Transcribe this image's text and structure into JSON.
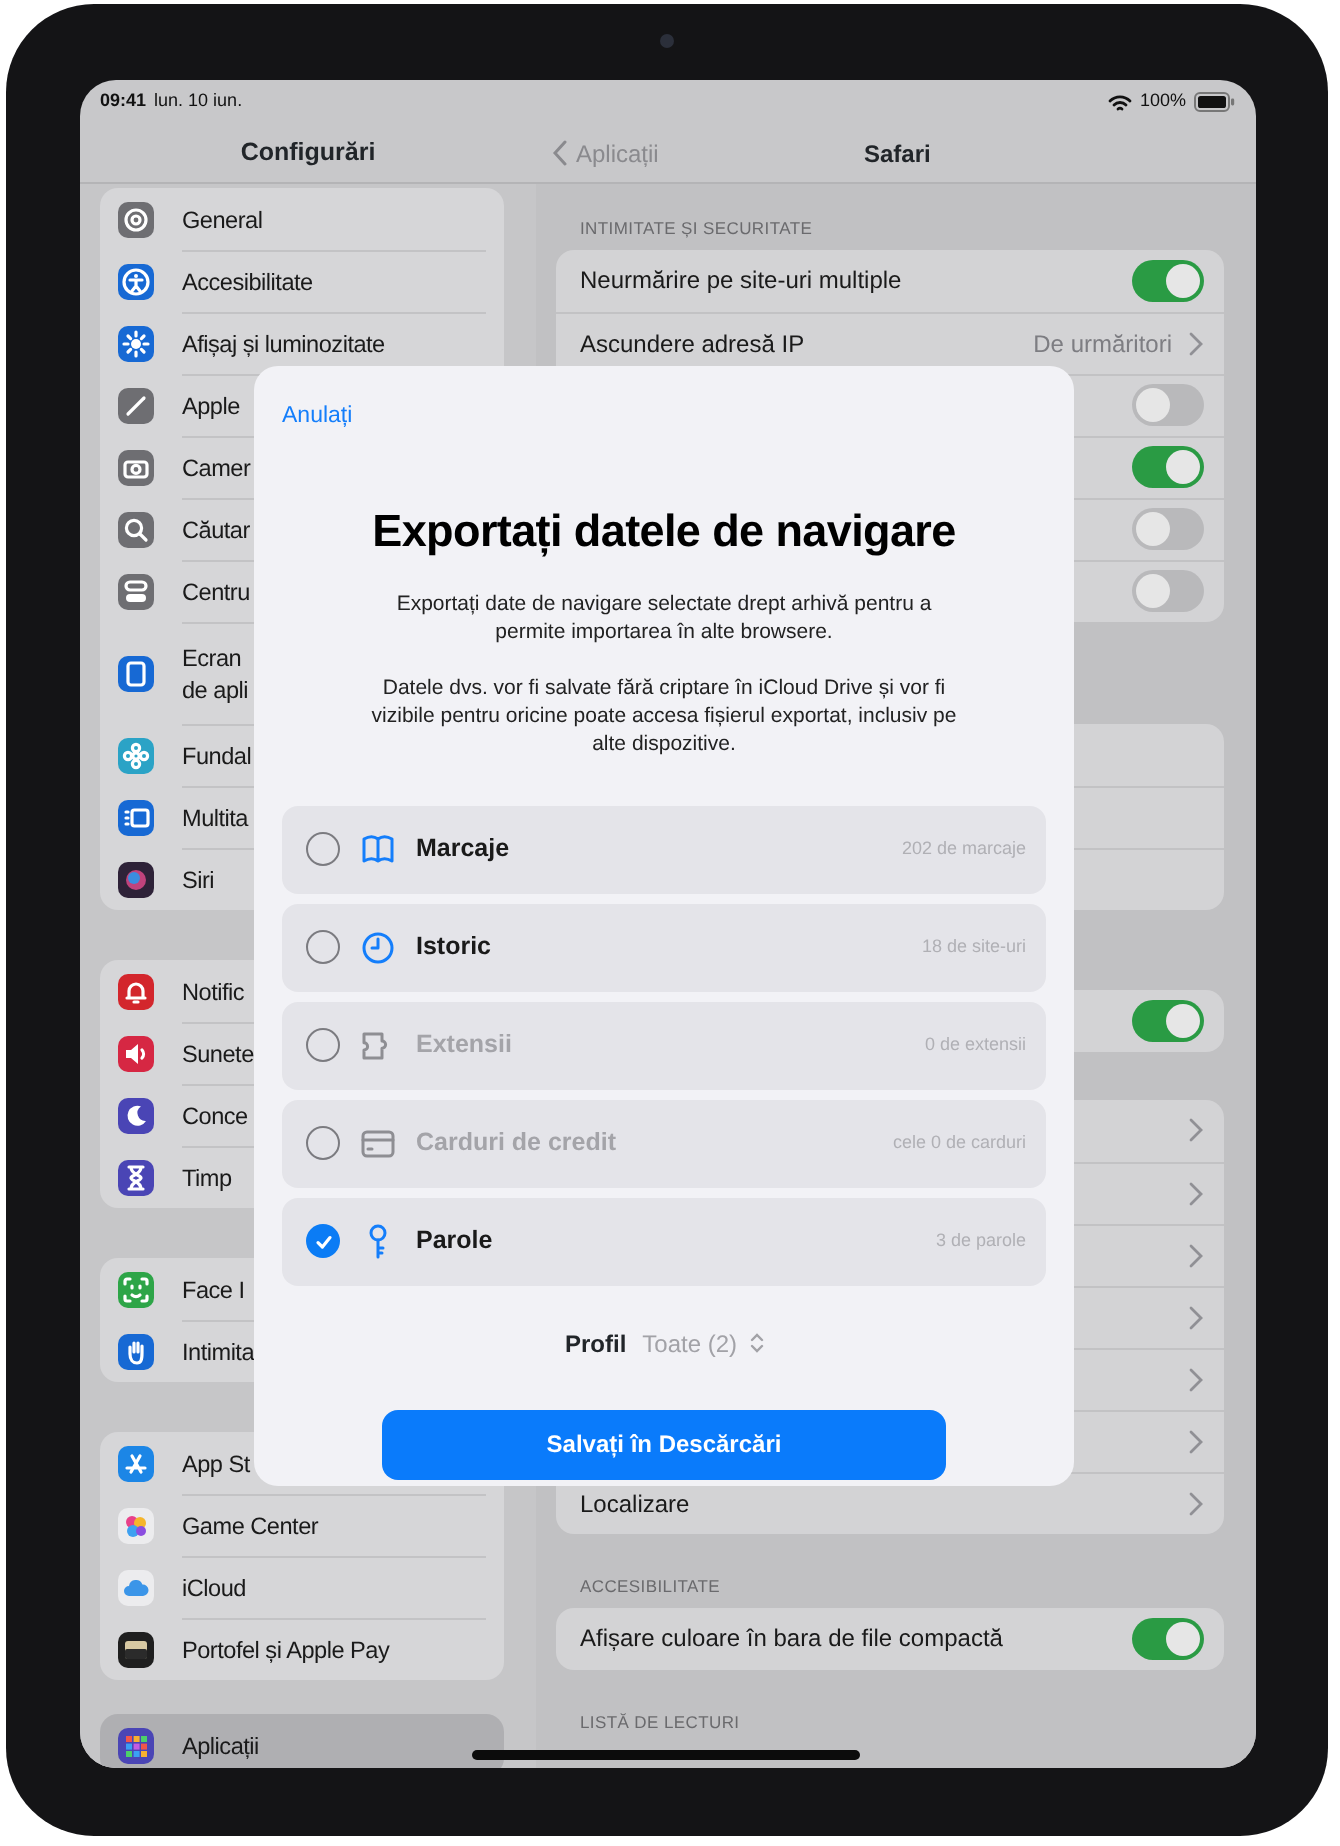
{
  "status_bar": {
    "time": "09:41",
    "date": "lun. 10 iun.",
    "battery": "100%"
  },
  "sidebar": {
    "title": "Configurări",
    "groups": [
      {
        "items": [
          {
            "label": "General",
            "color": "#6e6e72",
            "selected": false
          },
          {
            "label": "Accesibilitate",
            "color": "#1769d4",
            "selected": false
          },
          {
            "label": "Afișaj și luminozitate",
            "color": "#1769d4",
            "selected": false
          },
          {
            "label": "Apple",
            "color": "#6e6e72",
            "selected": false
          },
          {
            "label": "Camer",
            "color": "#6e6e72",
            "selected": false
          },
          {
            "label": "Căutar",
            "color": "#6e6e72",
            "selected": false
          },
          {
            "label": "Centru",
            "color": "#6e6e72",
            "selected": false
          },
          {
            "label": "Ecran\nde apli",
            "color": "#1769d4",
            "selected": false
          },
          {
            "label": "Fundal",
            "color": "#2ba3c6",
            "selected": false
          },
          {
            "label": "Multita",
            "color": "#1769d4",
            "selected": false
          },
          {
            "label": "Siri",
            "color": "#2e2238",
            "selected": false
          }
        ]
      },
      {
        "items": [
          {
            "label": "Notific",
            "color": "#d3262c",
            "selected": false
          },
          {
            "label": "Sunete",
            "color": "#d62743",
            "selected": false
          },
          {
            "label": "Conce",
            "color": "#4a45b5",
            "selected": false
          },
          {
            "label": "Timp",
            "color": "#4a45b5",
            "selected": false
          }
        ]
      },
      {
        "items": [
          {
            "label": "Face I",
            "color": "#2ea548",
            "selected": false
          },
          {
            "label": "Intimita",
            "color": "#1769d4",
            "selected": false
          }
        ]
      },
      {
        "items": [
          {
            "label": "App St",
            "color": "#1c86e6",
            "selected": false
          },
          {
            "label": "Game Center",
            "color": "#ececee",
            "selected": false
          },
          {
            "label": "iCloud",
            "color": "#ececee",
            "selected": false
          },
          {
            "label": "Portofel și Apple Pay",
            "color": "#1f1f1f",
            "selected": false
          }
        ]
      },
      {
        "items": [
          {
            "label": "Aplicații",
            "color": "#4a45b5",
            "selected": true
          }
        ]
      }
    ]
  },
  "detail": {
    "back": "Aplicații",
    "title": "Safari",
    "sections": [
      {
        "header": "INTIMITATE ȘI SECURITATE",
        "rows": [
          {
            "kind": "toggle",
            "label": "Neurmărire pe site-uri multiple",
            "on": true
          },
          {
            "kind": "value",
            "label": "Ascundere adresă IP",
            "value": "De urmăritori"
          },
          {
            "kind": "toggle",
            "on": false
          },
          {
            "kind": "toggle",
            "on": true
          },
          {
            "kind": "toggle",
            "on": false
          },
          {
            "kind": "toggle",
            "on": false
          }
        ]
      },
      {
        "rows": [
          {
            "kind": "plain"
          },
          {
            "kind": "plain"
          },
          {
            "kind": "plain"
          }
        ]
      },
      {
        "rows": [
          {
            "kind": "toggle",
            "on": true
          }
        ]
      },
      {
        "rows": [
          {
            "kind": "chevron"
          },
          {
            "kind": "chevron"
          },
          {
            "kind": "chevron"
          },
          {
            "kind": "chevron"
          },
          {
            "kind": "chevron"
          },
          {
            "kind": "chevron"
          },
          {
            "kind": "chevron",
            "label": "Localizare"
          }
        ]
      },
      {
        "header": "ACCESIBILITATE",
        "rows": [
          {
            "kind": "toggle",
            "label": "Afișare culoare în bara de file compactă",
            "on": true
          }
        ]
      },
      {
        "header": "LISTĂ DE LECTURI"
      }
    ]
  },
  "sheet": {
    "cancel": "Anulați",
    "title": "Exportați datele de navigare",
    "paragraphs": [
      "Exportați date de navigare selectate drept arhivă pentru a permite importarea în alte browsere.",
      "Datele dvs. vor fi salvate fără criptare în iCloud Drive și vor fi vizibile pentru oricine poate accesa fișierul exportat, inclusiv pe alte dispozitive."
    ],
    "options": [
      {
        "label": "Marcaje",
        "count": "202 de marcaje",
        "checked": false,
        "disabled": false
      },
      {
        "label": "Istoric",
        "count": "18 de site-uri",
        "checked": false,
        "disabled": false
      },
      {
        "label": "Extensii",
        "count": "0 de extensii",
        "checked": false,
        "disabled": true
      },
      {
        "label": "Carduri de credit",
        "count": "cele 0 de carduri",
        "checked": false,
        "disabled": true
      },
      {
        "label": "Parole",
        "count": "3 de parole",
        "checked": true,
        "disabled": false
      }
    ],
    "profile": {
      "label": "Profil",
      "value": "Toate (2)"
    },
    "button": "Salvați în Descărcări"
  }
}
